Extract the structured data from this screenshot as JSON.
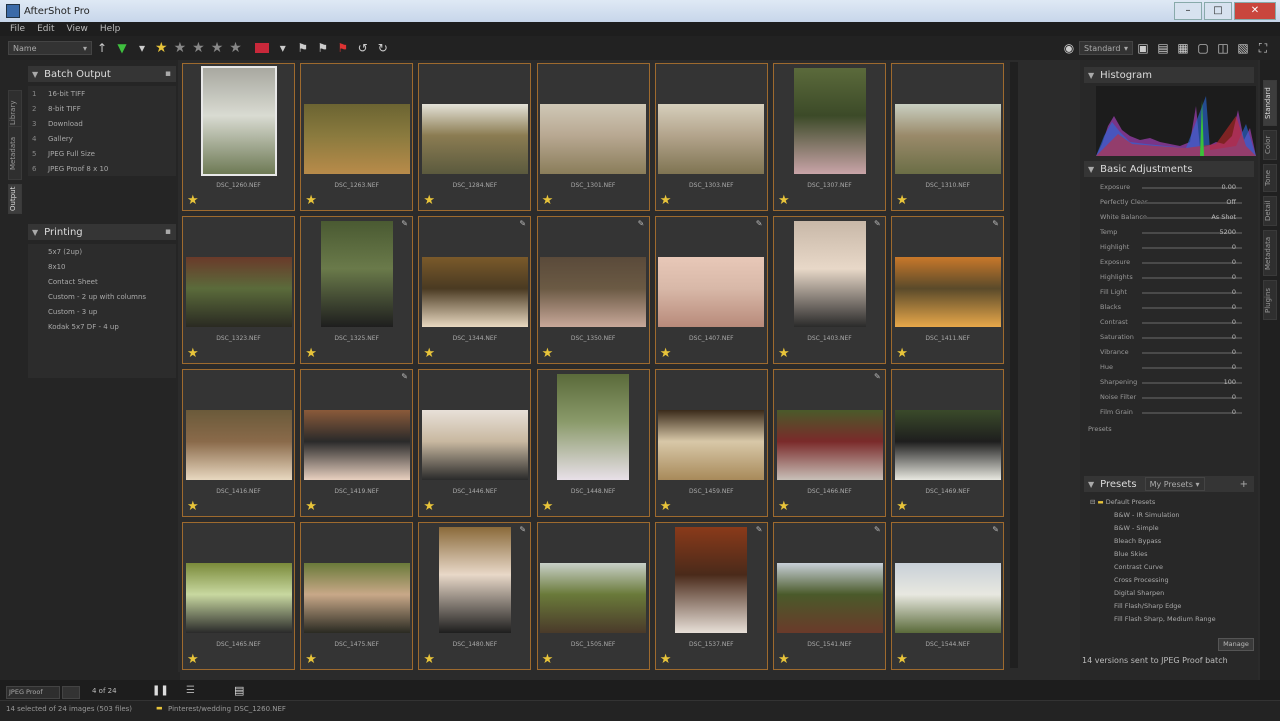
{
  "window": {
    "title": "AfterShot Pro",
    "buttons": {
      "minimize": "–",
      "maximize": "□",
      "close": "✕"
    }
  },
  "menu": [
    "File",
    "Edit",
    "View",
    "Help"
  ],
  "toolbar": {
    "sort_dropdown": "Name",
    "view_dropdown": "Standard",
    "stars": [
      true,
      false,
      false,
      false,
      false
    ]
  },
  "left_tabs": [
    "Library",
    "Metadata",
    "Output"
  ],
  "batch_output": {
    "header": "Batch Output",
    "items": [
      {
        "num": "1",
        "label": "16-bit TIFF"
      },
      {
        "num": "2",
        "label": "8-bit TIFF"
      },
      {
        "num": "3",
        "label": "Download"
      },
      {
        "num": "4",
        "label": "Gallery"
      },
      {
        "num": "5",
        "label": "JPEG Full Size"
      },
      {
        "num": "6",
        "label": "JPEG Proof 8 x 10"
      }
    ]
  },
  "printing": {
    "header": "Printing",
    "items": [
      "5x7 (2up)",
      "8x10",
      "Contact Sheet",
      "Custom - 2 up with columns",
      "Custom - 3 up",
      "Kodak 5x7 DF - 4 up"
    ]
  },
  "thumbnails": [
    {
      "name": "DSC_1260.NEF",
      "orient": "portrait",
      "colors": [
        "#a8a8a0",
        "#6e7a55",
        "#d9dbd2"
      ],
      "edited": false
    },
    {
      "name": "DSC_1263.NEF",
      "orient": "landscape",
      "colors": [
        "#6b6432",
        "#b88b4a",
        "#8a7a3e"
      ],
      "edited": false
    },
    {
      "name": "DSC_1284.NEF",
      "orient": "landscape",
      "colors": [
        "#e4e2d8",
        "#5b5a3e",
        "#8b7c52"
      ],
      "edited": false
    },
    {
      "name": "DSC_1301.NEF",
      "orient": "landscape",
      "colors": [
        "#cfc8b6",
        "#8a7d5a",
        "#b8a892"
      ],
      "edited": false
    },
    {
      "name": "DSC_1303.NEF",
      "orient": "landscape",
      "colors": [
        "#d6cfbc",
        "#7f7452",
        "#b3a48c"
      ],
      "edited": false
    },
    {
      "name": "DSC_1307.NEF",
      "orient": "portrait",
      "colors": [
        "#5b6a3b",
        "#c9a4a8",
        "#3c4a28"
      ],
      "edited": false
    },
    {
      "name": "DSC_1310.NEF",
      "orient": "landscape",
      "colors": [
        "#c9cfc1",
        "#6b6e46",
        "#9a8a6a"
      ],
      "edited": false
    },
    {
      "name": "DSC_1323.NEF",
      "orient": "landscape",
      "colors": [
        "#6a3a2a",
        "#2a2a22",
        "#5b6b3b"
      ],
      "edited": false
    },
    {
      "name": "DSC_1325.NEF",
      "orient": "portrait",
      "colors": [
        "#4a5a32",
        "#1e1e1e",
        "#6a7a4a"
      ],
      "edited": true
    },
    {
      "name": "DSC_1344.NEF",
      "orient": "landscape",
      "colors": [
        "#7a5a2a",
        "#e8d8c0",
        "#4a3a22"
      ],
      "edited": true
    },
    {
      "name": "DSC_1350.NEF",
      "orient": "landscape",
      "colors": [
        "#5a4a3a",
        "#c8a89a",
        "#6b5a44"
      ],
      "edited": true
    },
    {
      "name": "DSC_1407.NEF",
      "orient": "landscape",
      "colors": [
        "#e8c8b8",
        "#b88a7a",
        "#d8b8a8"
      ],
      "edited": true
    },
    {
      "name": "DSC_1403.NEF",
      "orient": "portrait",
      "colors": [
        "#c8b8a8",
        "#2a2a2a",
        "#e8d8c8"
      ],
      "edited": true
    },
    {
      "name": "DSC_1411.NEF",
      "orient": "landscape",
      "colors": [
        "#c8782a",
        "#e8a84a",
        "#5a4a2a"
      ],
      "edited": true
    },
    {
      "name": "DSC_1416.NEF",
      "orient": "landscape",
      "colors": [
        "#6a5a3a",
        "#e8d8c0",
        "#8a6a4a"
      ],
      "edited": false
    },
    {
      "name": "DSC_1419.NEF",
      "orient": "landscape",
      "colors": [
        "#8a5a3a",
        "#e8d0c0",
        "#2a2a2a"
      ],
      "edited": true
    },
    {
      "name": "DSC_1446.NEF",
      "orient": "landscape",
      "colors": [
        "#e8e0d8",
        "#2a2a2a",
        "#c8b8a0"
      ],
      "edited": false
    },
    {
      "name": "DSC_1448.NEF",
      "orient": "portrait",
      "colors": [
        "#5a6a3a",
        "#e8e0e8",
        "#8a9a6a"
      ],
      "edited": false
    },
    {
      "name": "DSC_1459.NEF",
      "orient": "landscape",
      "colors": [
        "#3a2a1a",
        "#a88a5a",
        "#d8c8a8"
      ],
      "edited": false
    },
    {
      "name": "DSC_1466.NEF",
      "orient": "landscape",
      "colors": [
        "#4a5a2a",
        "#c8c0b8",
        "#7a2a2a"
      ],
      "edited": true
    },
    {
      "name": "DSC_1469.NEF",
      "orient": "landscape",
      "colors": [
        "#3a4a2a",
        "#e8e8e0",
        "#1e1e1e"
      ],
      "edited": false
    },
    {
      "name": "DSC_1465.NEF",
      "orient": "landscape",
      "colors": [
        "#7a8a3a",
        "#2a2a2a",
        "#c8d8a0"
      ],
      "edited": false
    },
    {
      "name": "DSC_1475.NEF",
      "orient": "landscape",
      "colors": [
        "#6a7a3a",
        "#2a2a22",
        "#c8a888"
      ],
      "edited": false
    },
    {
      "name": "DSC_1480.NEF",
      "orient": "portrait",
      "colors": [
        "#8a6a3a",
        "#1e1e1e",
        "#e8d8c8"
      ],
      "edited": true
    },
    {
      "name": "DSC_1505.NEF",
      "orient": "landscape",
      "colors": [
        "#c8d0c8",
        "#4a3a2a",
        "#6a7a3a"
      ],
      "edited": false
    },
    {
      "name": "DSC_1537.NEF",
      "orient": "portrait",
      "colors": [
        "#8a3a1a",
        "#e8e0d8",
        "#4a2a1a"
      ],
      "edited": true
    },
    {
      "name": "DSC_1541.NEF",
      "orient": "landscape",
      "colors": [
        "#c8d0d8",
        "#6a3a2a",
        "#4a5a2a"
      ],
      "edited": true
    },
    {
      "name": "DSC_1544.NEF",
      "orient": "landscape",
      "colors": [
        "#c8d0d8",
        "#5a6a3a",
        "#e8e8e0"
      ],
      "edited": true
    }
  ],
  "histogram": {
    "header": "Histogram"
  },
  "basic_adjustments": {
    "header": "Basic Adjustments",
    "rows": [
      {
        "label": "Exposure",
        "value": "0.00"
      },
      {
        "label": "Perfectly Clear",
        "value": "Off"
      },
      {
        "label": "White Balance",
        "value": "As Shot"
      },
      {
        "label": "Temp",
        "value": "5200"
      },
      {
        "label": "Highlight",
        "value": "0"
      },
      {
        "label": "Exposure",
        "value": "0"
      },
      {
        "label": "Highlights",
        "value": "0"
      },
      {
        "label": "Fill Light",
        "value": "0"
      },
      {
        "label": "Blacks",
        "value": "0"
      },
      {
        "label": "Contrast",
        "value": "0"
      },
      {
        "label": "Saturation",
        "value": "0"
      },
      {
        "label": "Vibrance",
        "value": "0"
      },
      {
        "label": "Hue",
        "value": "0"
      },
      {
        "label": "Sharpening",
        "value": "100"
      },
      {
        "label": "Noise Filter",
        "value": "0"
      },
      {
        "label": "Film Grain",
        "value": "0"
      }
    ],
    "presets_link": "Presets"
  },
  "presets": {
    "header": "Presets",
    "dropdown": "My Presets",
    "folder": "Default Presets",
    "items": [
      "B&W - IR Simulation",
      "B&W - Simple",
      "Bleach Bypass",
      "Blue Skies",
      "Contrast Curve",
      "Cross Processing",
      "Digital Sharpen",
      "Fill Flash/Sharp Edge",
      "Fill Flash Sharp, Medium Range"
    ],
    "manage_button": "Manage",
    "status": "14 versions sent to JPEG Proof batch"
  },
  "right_tabs": [
    "Standard",
    "Color",
    "Tone",
    "Detail",
    "Metadata",
    "Plugins"
  ],
  "status": {
    "left_field": "JPEG Proof",
    "count": "4 of 24",
    "selection": "14 selected of 24 images (503 files)",
    "folder": "Pinterest/wedding",
    "file": "DSC_1260.NEF"
  }
}
